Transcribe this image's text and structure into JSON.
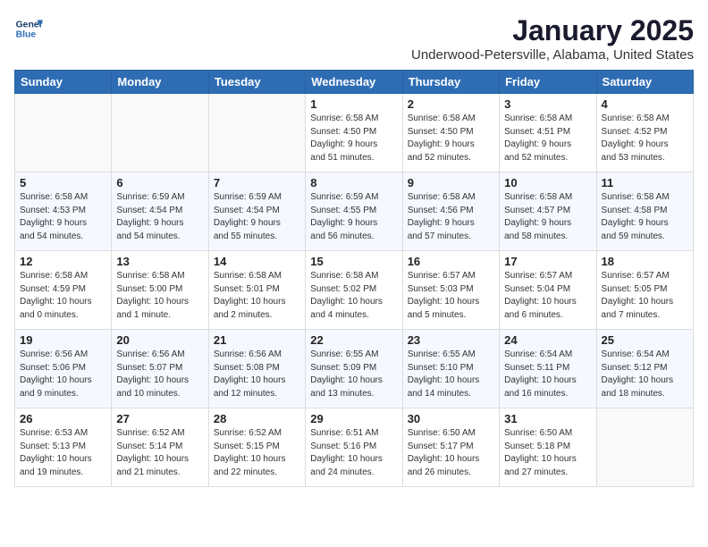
{
  "header": {
    "logo_line1": "General",
    "logo_line2": "Blue",
    "month": "January 2025",
    "location": "Underwood-Petersville, Alabama, United States"
  },
  "weekdays": [
    "Sunday",
    "Monday",
    "Tuesday",
    "Wednesday",
    "Thursday",
    "Friday",
    "Saturday"
  ],
  "weeks": [
    [
      {
        "day": "",
        "info": ""
      },
      {
        "day": "",
        "info": ""
      },
      {
        "day": "",
        "info": ""
      },
      {
        "day": "1",
        "info": "Sunrise: 6:58 AM\nSunset: 4:50 PM\nDaylight: 9 hours\nand 51 minutes."
      },
      {
        "day": "2",
        "info": "Sunrise: 6:58 AM\nSunset: 4:50 PM\nDaylight: 9 hours\nand 52 minutes."
      },
      {
        "day": "3",
        "info": "Sunrise: 6:58 AM\nSunset: 4:51 PM\nDaylight: 9 hours\nand 52 minutes."
      },
      {
        "day": "4",
        "info": "Sunrise: 6:58 AM\nSunset: 4:52 PM\nDaylight: 9 hours\nand 53 minutes."
      }
    ],
    [
      {
        "day": "5",
        "info": "Sunrise: 6:58 AM\nSunset: 4:53 PM\nDaylight: 9 hours\nand 54 minutes."
      },
      {
        "day": "6",
        "info": "Sunrise: 6:59 AM\nSunset: 4:54 PM\nDaylight: 9 hours\nand 54 minutes."
      },
      {
        "day": "7",
        "info": "Sunrise: 6:59 AM\nSunset: 4:54 PM\nDaylight: 9 hours\nand 55 minutes."
      },
      {
        "day": "8",
        "info": "Sunrise: 6:59 AM\nSunset: 4:55 PM\nDaylight: 9 hours\nand 56 minutes."
      },
      {
        "day": "9",
        "info": "Sunrise: 6:58 AM\nSunset: 4:56 PM\nDaylight: 9 hours\nand 57 minutes."
      },
      {
        "day": "10",
        "info": "Sunrise: 6:58 AM\nSunset: 4:57 PM\nDaylight: 9 hours\nand 58 minutes."
      },
      {
        "day": "11",
        "info": "Sunrise: 6:58 AM\nSunset: 4:58 PM\nDaylight: 9 hours\nand 59 minutes."
      }
    ],
    [
      {
        "day": "12",
        "info": "Sunrise: 6:58 AM\nSunset: 4:59 PM\nDaylight: 10 hours\nand 0 minutes."
      },
      {
        "day": "13",
        "info": "Sunrise: 6:58 AM\nSunset: 5:00 PM\nDaylight: 10 hours\nand 1 minute."
      },
      {
        "day": "14",
        "info": "Sunrise: 6:58 AM\nSunset: 5:01 PM\nDaylight: 10 hours\nand 2 minutes."
      },
      {
        "day": "15",
        "info": "Sunrise: 6:58 AM\nSunset: 5:02 PM\nDaylight: 10 hours\nand 4 minutes."
      },
      {
        "day": "16",
        "info": "Sunrise: 6:57 AM\nSunset: 5:03 PM\nDaylight: 10 hours\nand 5 minutes."
      },
      {
        "day": "17",
        "info": "Sunrise: 6:57 AM\nSunset: 5:04 PM\nDaylight: 10 hours\nand 6 minutes."
      },
      {
        "day": "18",
        "info": "Sunrise: 6:57 AM\nSunset: 5:05 PM\nDaylight: 10 hours\nand 7 minutes."
      }
    ],
    [
      {
        "day": "19",
        "info": "Sunrise: 6:56 AM\nSunset: 5:06 PM\nDaylight: 10 hours\nand 9 minutes."
      },
      {
        "day": "20",
        "info": "Sunrise: 6:56 AM\nSunset: 5:07 PM\nDaylight: 10 hours\nand 10 minutes."
      },
      {
        "day": "21",
        "info": "Sunrise: 6:56 AM\nSunset: 5:08 PM\nDaylight: 10 hours\nand 12 minutes."
      },
      {
        "day": "22",
        "info": "Sunrise: 6:55 AM\nSunset: 5:09 PM\nDaylight: 10 hours\nand 13 minutes."
      },
      {
        "day": "23",
        "info": "Sunrise: 6:55 AM\nSunset: 5:10 PM\nDaylight: 10 hours\nand 14 minutes."
      },
      {
        "day": "24",
        "info": "Sunrise: 6:54 AM\nSunset: 5:11 PM\nDaylight: 10 hours\nand 16 minutes."
      },
      {
        "day": "25",
        "info": "Sunrise: 6:54 AM\nSunset: 5:12 PM\nDaylight: 10 hours\nand 18 minutes."
      }
    ],
    [
      {
        "day": "26",
        "info": "Sunrise: 6:53 AM\nSunset: 5:13 PM\nDaylight: 10 hours\nand 19 minutes."
      },
      {
        "day": "27",
        "info": "Sunrise: 6:52 AM\nSunset: 5:14 PM\nDaylight: 10 hours\nand 21 minutes."
      },
      {
        "day": "28",
        "info": "Sunrise: 6:52 AM\nSunset: 5:15 PM\nDaylight: 10 hours\nand 22 minutes."
      },
      {
        "day": "29",
        "info": "Sunrise: 6:51 AM\nSunset: 5:16 PM\nDaylight: 10 hours\nand 24 minutes."
      },
      {
        "day": "30",
        "info": "Sunrise: 6:50 AM\nSunset: 5:17 PM\nDaylight: 10 hours\nand 26 minutes."
      },
      {
        "day": "31",
        "info": "Sunrise: 6:50 AM\nSunset: 5:18 PM\nDaylight: 10 hours\nand 27 minutes."
      },
      {
        "day": "",
        "info": ""
      }
    ]
  ]
}
